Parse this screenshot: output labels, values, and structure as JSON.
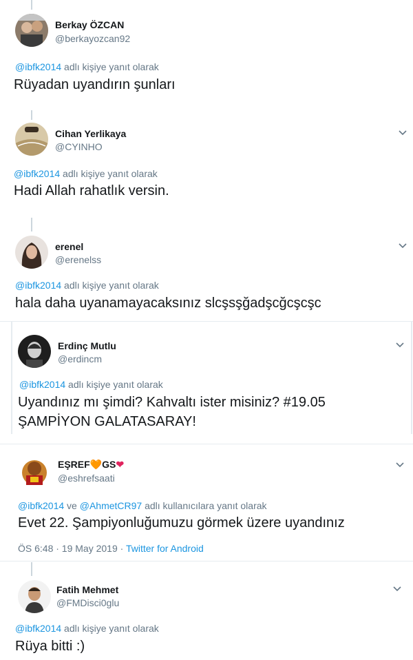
{
  "tweets": [
    {
      "name": "Berkay ÖZCAN",
      "handle": "@berkayozcan92",
      "reply_mention": "@ibfk2014",
      "reply_suffix": " adlı kişiye yanıt olarak",
      "text": "Rüyadan uyandırın şunları"
    },
    {
      "name": "Cihan Yerlikaya",
      "handle": "@CYINHO",
      "reply_mention": "@ibfk2014",
      "reply_suffix": " adlı kişiye yanıt olarak",
      "text": "Hadi Allah rahatlık versin."
    },
    {
      "name": "erenel",
      "handle": "@erenelss",
      "reply_mention": "@ibfk2014",
      "reply_suffix": " adlı kişiye yanıt olarak",
      "text": "hala daha uyanamayacaksınız slcşsşğadşcğcşcşc"
    },
    {
      "name": "Erdinç Mutlu",
      "handle": "@erdincm",
      "reply_mention": "@ibfk2014",
      "reply_suffix": " adlı kişiye yanıt olarak",
      "text_line1": "Uyandınız mı şimdi? Kahvaltı ister misiniz? #19.05",
      "text_line2": "ŞAMPİYON GALATASARAY!"
    },
    {
      "name_prefix": "EŞREF",
      "name_mid": "GS",
      "handle": "@eshrefsaati",
      "reply_mention1": "@ibfk2014",
      "reply_and": " ve ",
      "reply_mention2": "@AhmetCR97",
      "reply_suffix": " adlı kullanıcılara yanıt olarak",
      "text": "Evet 22. Şampiyonluğumuzu görmek üzere uyandınız",
      "time": "ÖS 6:48 · 19 May 2019 · ",
      "source": "Twitter for Android"
    },
    {
      "name": "Fatih Mehmet",
      "handle": "@FMDisci0glu",
      "reply_mention": "@ibfk2014",
      "reply_suffix": " adlı kişiye yanıt olarak",
      "text": "Rüya bitti :)"
    }
  ],
  "icons": {
    "chevron": "chevron-down-icon",
    "orange_heart": "🧡",
    "red_heart": "❤"
  },
  "colors": {
    "link": "#1b95e0",
    "muted": "#657786",
    "text": "#14171a"
  }
}
